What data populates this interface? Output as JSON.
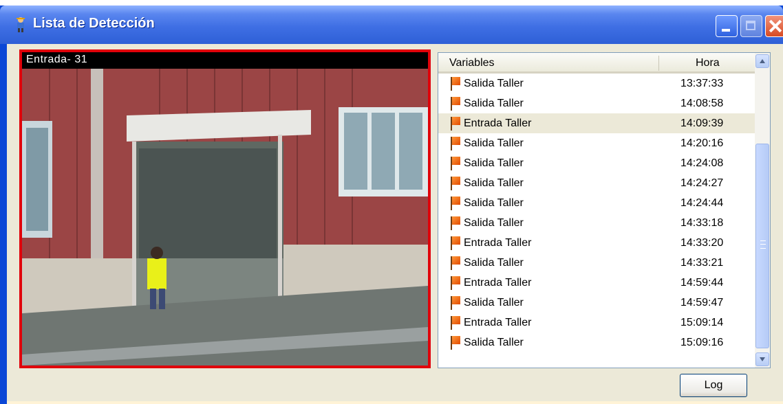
{
  "window": {
    "title": "Lista de Detección",
    "icon": "person-icon",
    "controls": [
      "minimize-icon",
      "maximize-icon",
      "close-icon"
    ]
  },
  "camera": {
    "label": "Entrada- 31",
    "border_color": "#e0000b"
  },
  "list": {
    "columns": {
      "variables": "Variables",
      "hora": "Hora"
    },
    "rows": [
      {
        "variable": "Salida Taller",
        "time": "13:37:33"
      },
      {
        "variable": "Salida Taller",
        "time": "14:08:58"
      },
      {
        "variable": "Entrada Taller",
        "time": "14:09:39"
      },
      {
        "variable": "Salida Taller",
        "time": "14:20:16"
      },
      {
        "variable": "Salida Taller",
        "time": "14:24:08"
      },
      {
        "variable": "Salida Taller",
        "time": "14:24:27"
      },
      {
        "variable": "Salida Taller",
        "time": "14:24:44"
      },
      {
        "variable": "Salida Taller",
        "time": "14:33:18"
      },
      {
        "variable": "Entrada Taller",
        "time": "14:33:20"
      },
      {
        "variable": "Salida Taller",
        "time": "14:33:21"
      },
      {
        "variable": "Entrada Taller",
        "time": "14:59:44"
      },
      {
        "variable": "Salida Taller",
        "time": "14:59:47"
      },
      {
        "variable": "Entrada Taller",
        "time": "15:09:14"
      },
      {
        "variable": "Salida Taller",
        "time": "15:09:16"
      }
    ],
    "selected_index": 2,
    "row_icon": "flag-icon"
  },
  "buttons": {
    "log": "Log"
  },
  "colors": {
    "titlebar": "#3f6fe4",
    "client_bg": "#ece9d8",
    "selection": "#ece9d8",
    "flag": "#e24a00"
  }
}
